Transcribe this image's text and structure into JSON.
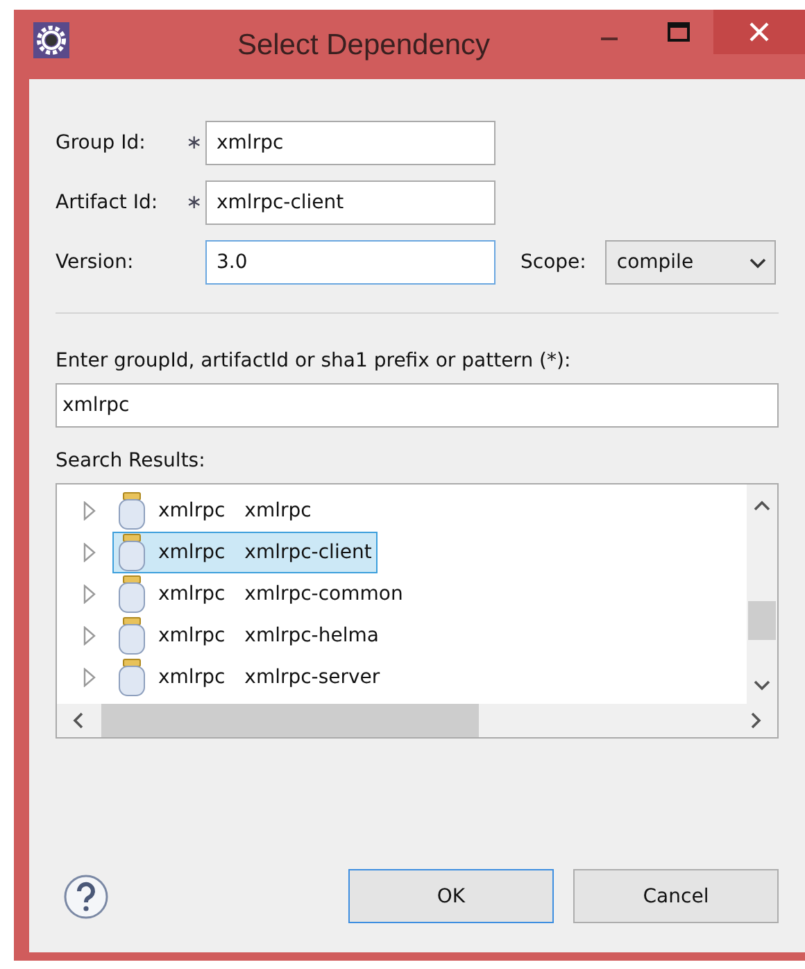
{
  "window": {
    "title": "Select Dependency"
  },
  "fields": [
    {
      "label": "Group Id:",
      "mark": "∗",
      "value": "xmlrpc",
      "focused": false
    },
    {
      "label": "Artifact Id:",
      "mark": "∗",
      "value": "xmlrpc-client",
      "focused": false
    },
    {
      "label": "Version:",
      "value": "3.0",
      "focused": true
    }
  ],
  "scope": {
    "label": "Scope:",
    "value": "compile"
  },
  "search": {
    "label": "Enter groupId, artifactId or sha1 prefix or pattern (*):",
    "value": "xmlrpc"
  },
  "results": {
    "label": "Search Results:",
    "items": [
      {
        "group": "xmlrpc",
        "artifact": "xmlrpc",
        "selected": false
      },
      {
        "group": "xmlrpc",
        "artifact": "xmlrpc-client",
        "selected": true
      },
      {
        "group": "xmlrpc",
        "artifact": "xmlrpc-common",
        "selected": false
      },
      {
        "group": "xmlrpc",
        "artifact": "xmlrpc-helma",
        "selected": false
      },
      {
        "group": "xmlrpc",
        "artifact": "xmlrpc-server",
        "selected": false
      }
    ]
  },
  "buttons": [
    {
      "label": "OK",
      "default": true
    },
    {
      "label": "Cancel",
      "default": false
    }
  ]
}
